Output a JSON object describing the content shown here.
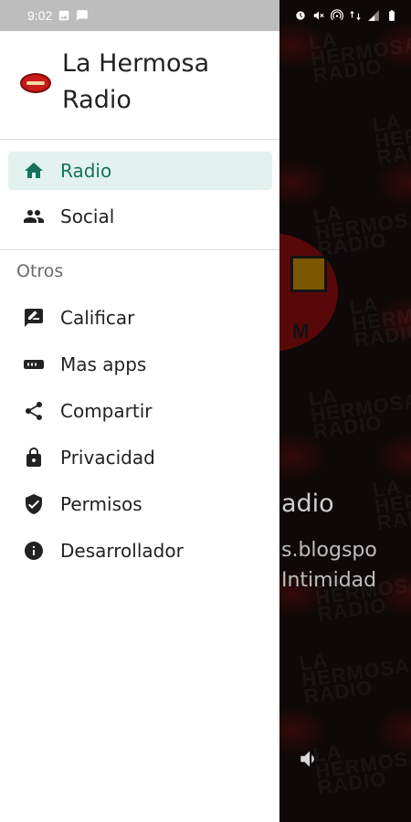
{
  "status_bar": {
    "time": "9:02"
  },
  "drawer": {
    "app_name": "La Hermosa Radio",
    "primary_items": [
      {
        "label": "Radio",
        "icon": "home-icon",
        "active": true
      },
      {
        "label": "Social",
        "icon": "people-icon",
        "active": false
      }
    ],
    "section_title": "Otros",
    "secondary_items": [
      {
        "label": "Calificar",
        "icon": "rate-review-icon"
      },
      {
        "label": "Mas apps",
        "icon": "shop-icon"
      },
      {
        "label": "Compartir",
        "icon": "share-icon"
      },
      {
        "label": "Privacidad",
        "icon": "lock-icon"
      },
      {
        "label": "Permisos",
        "icon": "verified-shield-icon"
      },
      {
        "label": "Desarrollador",
        "icon": "info-icon"
      }
    ]
  },
  "background_app": {
    "title_partial": "adio",
    "subtitle_line1": "s.blogspo",
    "subtitle_line2": "Intimidad"
  },
  "colors": {
    "accent": "#15735b",
    "active_bg": "#e3f2ee",
    "drawer_bg": "#ffffff",
    "status_bar_drawer": "#bdbdbd"
  }
}
